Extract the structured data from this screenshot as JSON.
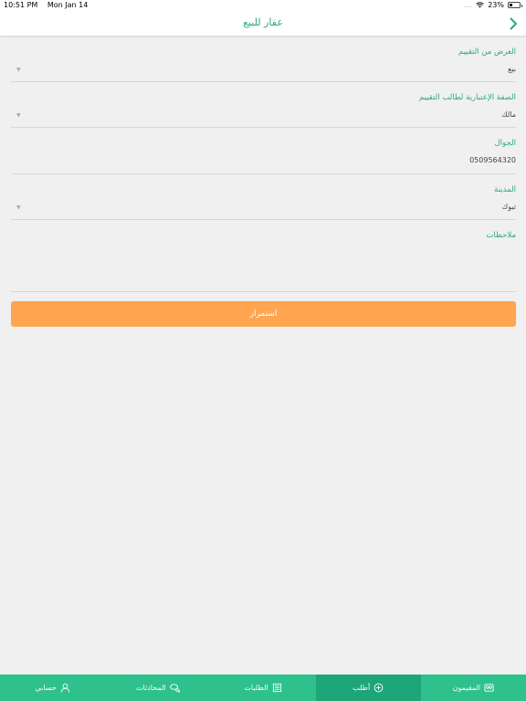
{
  "status_bar": {
    "time": "10:51 PM",
    "date": "Mon Jan 14",
    "signal": "....",
    "battery": "23%"
  },
  "header": {
    "title": "عقار للبيع"
  },
  "form": {
    "fields": [
      {
        "label": "العرض من التقييم",
        "value": "بيع"
      },
      {
        "label": "الصفة الإعتبارية لطالب التقييم",
        "value": "مالك"
      },
      {
        "label": "الجوال",
        "value": "0509564320"
      },
      {
        "label": "المدينة",
        "value": "تبوك"
      },
      {
        "label": "ملاحظات",
        "value": ""
      }
    ],
    "continue_label": "استمرار"
  },
  "tabs": [
    {
      "label": "المقيمون",
      "icon": "appraisers-icon",
      "active": false
    },
    {
      "label": "أطلب",
      "icon": "plus-circle-icon",
      "active": true
    },
    {
      "label": "الطلبات",
      "icon": "orders-icon",
      "active": false
    },
    {
      "label": "المحادثات",
      "icon": "chat-icon",
      "active": false
    },
    {
      "label": "حسابي",
      "icon": "user-icon",
      "active": false
    }
  ],
  "colors": {
    "accent": "#2aa87a",
    "tab_bar": "#2ec08d",
    "tab_active": "#1ea57a",
    "button": "#ffa451"
  }
}
